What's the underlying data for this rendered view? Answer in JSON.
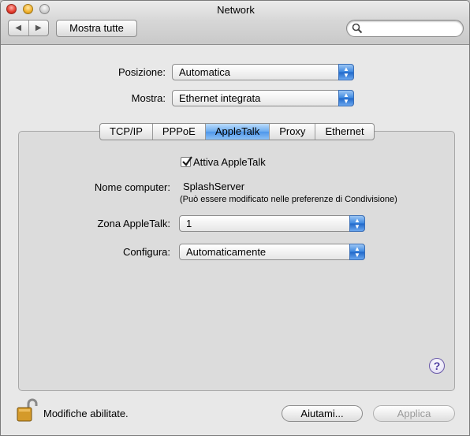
{
  "window": {
    "title": "Network"
  },
  "toolbar": {
    "back": "◀",
    "forward": "▶",
    "show_all": "Mostra tutte",
    "search_value": ""
  },
  "location": {
    "label": "Posizione:",
    "value": "Automatica"
  },
  "show": {
    "label": "Mostra:",
    "value": "Ethernet integrata"
  },
  "tabs": [
    "TCP/IP",
    "PPPoE",
    "AppleTalk",
    "Proxy",
    "Ethernet"
  ],
  "active_tab": "AppleTalk",
  "appletalk": {
    "enable_label": "Attiva AppleTalk",
    "enabled": true,
    "computer_name_label": "Nome computer:",
    "computer_name": "SplashServer",
    "computer_name_note": "(Può essere modificato nelle preferenze di Condivisione)",
    "zone_label": "Zona AppleTalk:",
    "zone_value": "1",
    "configure_label": "Configura:",
    "configure_value": "Automaticamente"
  },
  "footer": {
    "help": "?",
    "lock_text": "Modifiche abilitate.",
    "assist_button": "Aiutami...",
    "apply_button": "Applica"
  }
}
